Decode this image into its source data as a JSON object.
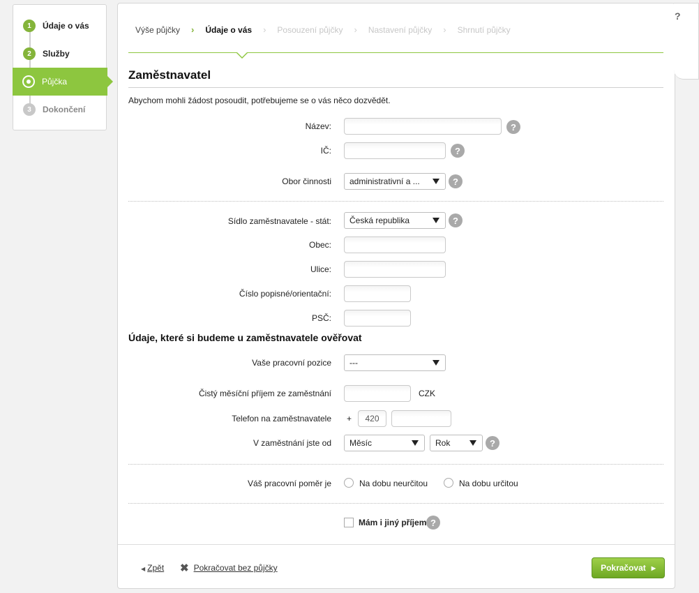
{
  "sidebar": {
    "items": [
      {
        "num": "1",
        "label": "Údaje o vás"
      },
      {
        "num": "2",
        "label": "Služby"
      },
      {
        "num": "",
        "label": "Půjčka"
      },
      {
        "num": "3",
        "label": "Dokončení"
      }
    ]
  },
  "help_corner": "?",
  "steps": [
    "Výše půjčky",
    "Údaje o vás",
    "Posouzení půjčky",
    "Nastavení půjčky",
    "Shrnutí půjčky"
  ],
  "step_separator": "›",
  "section_title": "Zaměstnavatel",
  "intro": "Abychom mohli žádost posoudit, potřebujeme se o vás něco dozvědět.",
  "help_icon": "?",
  "fields": {
    "nazev": "Název:",
    "ic": "IČ:",
    "obor": "Obor činnosti",
    "obor_value": "administrativní a ...",
    "sidlo": "Sídlo zaměstnavatele - stát:",
    "sidlo_value": "Česká republika",
    "obec": "Obec:",
    "ulice": "Ulice:",
    "cislo": "Číslo popisné/orientační:",
    "psc": "PSČ:"
  },
  "verify_title": "Údaje, které si budeme u zaměstnavatele ověřovat",
  "verify": {
    "pozice": "Vaše pracovní pozice",
    "pozice_value": "---",
    "prijem": "Čistý měsíční příjem ze zaměstnání",
    "currency": "CZK",
    "telefon": "Telefon na zaměstnavatele",
    "plus": "+",
    "prefix": "420",
    "od": "V zaměstnání jste od",
    "mesic": "Měsíc",
    "rok": "Rok",
    "pomer": "Váš pracovní poměr je",
    "neurcitou": "Na dobu neurčitou",
    "urcitou": "Na dobu určitou",
    "jiny_prijem": "Mám i jiný příjem"
  },
  "footer": {
    "back": "Zpět",
    "back_arrow": "◀",
    "skip": "Pokračovat bez půjčky",
    "skip_icon": "✖",
    "continue": "Pokračovat",
    "continue_arrow": "▶"
  },
  "colors": {
    "accent": "#8dc63f",
    "button": "#7ab32e"
  }
}
